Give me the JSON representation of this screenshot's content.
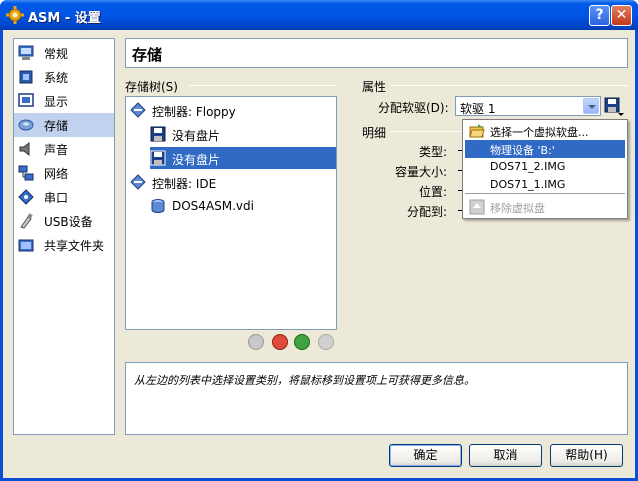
{
  "window": {
    "title": "ASM - 设置",
    "help_label": "?",
    "close_label": "✕"
  },
  "sidebar": {
    "items": [
      {
        "label": "常规",
        "icon": "monitor-icon"
      },
      {
        "label": "系统",
        "icon": "chip-icon"
      },
      {
        "label": "显示",
        "icon": "display-icon"
      },
      {
        "label": "存储",
        "icon": "disk-icon",
        "selected": true
      },
      {
        "label": "声音",
        "icon": "speaker-icon"
      },
      {
        "label": "网络",
        "icon": "network-icon"
      },
      {
        "label": "串口",
        "icon": "serial-icon"
      },
      {
        "label": "USB设备",
        "icon": "usb-icon"
      },
      {
        "label": "共享文件夹",
        "icon": "folder-icon"
      }
    ]
  },
  "page": {
    "title": "存储"
  },
  "tree": {
    "heading": "存储树(S)",
    "rows": [
      {
        "label": "控制器: Floppy"
      },
      {
        "label": "没有盘片"
      },
      {
        "label": "没有盘片"
      },
      {
        "label": "控制器: IDE"
      },
      {
        "label": "DOS4ASM.vdi"
      }
    ]
  },
  "attributes": {
    "heading": "属性",
    "slot_label": "分配软驱(D):",
    "slot_value": "软驱 1"
  },
  "details": {
    "heading": "明细",
    "type_label": "类型:",
    "size_label": "容量大小:",
    "location_label": "位置:",
    "attached_label": "分配到:"
  },
  "dropdown": {
    "items": [
      {
        "label": "选择一个虚拟软盘..."
      },
      {
        "label": "物理设备 'B:'"
      },
      {
        "label": "DOS71_2.IMG"
      },
      {
        "label": "DOS71_1.IMG"
      },
      {
        "label": "移除虚拟盘"
      }
    ]
  },
  "info": {
    "text": "从左边的列表中选择设置类别，将鼠标移到设置项上可获得更多信息。"
  },
  "buttons": {
    "ok": "确定",
    "cancel": "取消",
    "help": "帮助(H)"
  }
}
